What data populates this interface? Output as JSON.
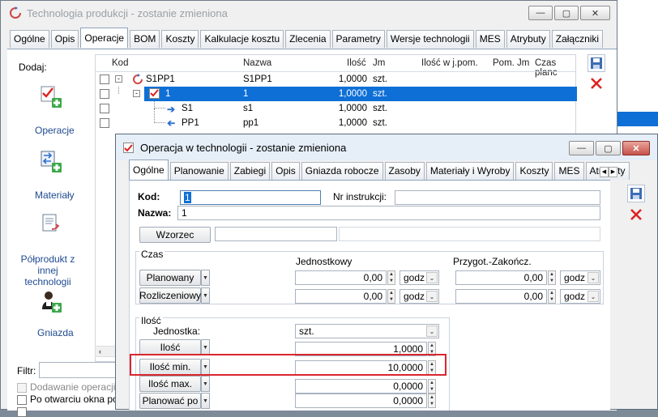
{
  "bg_window": {
    "title": "Technologia produkcji - zostanie zmieniona",
    "tabs": [
      "Ogólne",
      "Opis",
      "Operacje",
      "BOM",
      "Koszty",
      "Kalkulacje kosztu",
      "Zlecenia",
      "Parametry",
      "Wersje technologii",
      "MES",
      "Atrybuty",
      "Załączniki"
    ],
    "active_tab": "Operacje",
    "dodaj_label": "Dodaj:",
    "side_items": [
      {
        "label": "Operacje",
        "icon": "operation-add-icon"
      },
      {
        "label": "Materiały",
        "icon": "materials-add-icon"
      },
      {
        "label": "Półprodukt z innej technologii",
        "icon": "semiproduct-icon"
      },
      {
        "label": "Gniazda",
        "icon": "workstation-icon"
      }
    ],
    "grid_headers": [
      "Kod",
      "Nazwa",
      "Ilość",
      "Jm",
      "Ilość w j.pom.",
      "Pom. Jm",
      "Czas planc"
    ],
    "rows": [
      {
        "kod": "S1PP1",
        "nazwa": "S1PP1",
        "ilosc": "1,0000",
        "jm": "szt.",
        "selected": false
      },
      {
        "kod": "1",
        "nazwa": "1",
        "ilosc": "1,0000",
        "jm": "szt.",
        "selected": true
      },
      {
        "kod": "S1",
        "nazwa": "s1",
        "ilosc": "1,0000",
        "jm": "szt.",
        "selected": false
      },
      {
        "kod": "PP1",
        "nazwa": "pp1",
        "ilosc": "1,0000",
        "jm": "szt.",
        "selected": false
      }
    ],
    "filter_label": "Filtr:",
    "checkboxes": [
      "Dodawanie operacji w",
      "Po otwarciu okna poka"
    ]
  },
  "dialog": {
    "title": "Operacja w technologii - zostanie zmieniona",
    "tabs": [
      "Ogólne",
      "Planowanie",
      "Zabiegi",
      "Opis",
      "Gniazda robocze",
      "Zasoby",
      "Materiały i Wyroby",
      "Koszty",
      "MES",
      "Atrybuty"
    ],
    "active_tab": "Ogólne",
    "kod_label": "Kod:",
    "kod_value": "1",
    "nr_instr_label": "Nr instrukcji:",
    "nr_instr_value": "",
    "nazwa_label": "Nazwa:",
    "nazwa_value": "1",
    "wzorzec_label": "Wzorzec",
    "czas_label": "Czas",
    "jednostkowy_label": "Jednostkowy",
    "przygot_label": "Przygot.-Zakończ.",
    "planowany_label": "Planowany",
    "rozliczeniowy_label": "Rozliczeniowy",
    "time_values": [
      "0,00",
      "0,00",
      "0,00",
      "0,00"
    ],
    "unit_godz": "godz",
    "ilosc_label": "Ilość",
    "jednostka_label": "Jednostka:",
    "jednostka_value": "szt.",
    "ilosc_btn": "Ilość",
    "ilosc_value": "1,0000",
    "ilosc_min_btn": "Ilość min.",
    "ilosc_min_value": "10,0000",
    "ilosc_max_btn": "Ilość max.",
    "ilosc_max_value": "0,0000",
    "planowac_btn": "Planować po",
    "planowac_value": "0,0000",
    "highlight_color": "#d9262e"
  }
}
